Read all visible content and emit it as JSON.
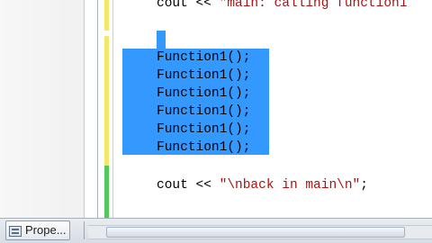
{
  "editor": {
    "top_line_prefix": "cout << ",
    "top_line_string": "\"main: calling function1",
    "selected_lines": [
      "Function1();",
      "Function1();",
      "Function1();",
      "Function1();",
      "Function1();",
      "Function1();"
    ],
    "bottom_line_prefix": "cout << ",
    "bottom_line_string": "\"\\nback in main\\n\"",
    "bottom_line_suffix": ";"
  },
  "bottom_tabs": {
    "properties_label": "Prope..."
  },
  "colors": {
    "selection": "#3399ff",
    "changed_margin": "#f2e76a",
    "saved_margin": "#53c85a",
    "string_literal": "#a31515"
  }
}
